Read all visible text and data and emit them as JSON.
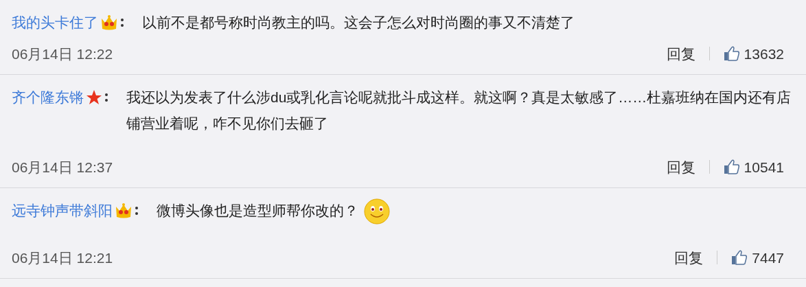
{
  "comments": [
    {
      "user": "我的头卡住了",
      "badge": {
        "kind": "crown"
      },
      "text": "以前不是都号称时尚教主的吗。这会子怎么对时尚圈的事又不清楚了",
      "time": "06月14日 12:22",
      "reply": "回复",
      "likes": "13632"
    },
    {
      "user": "齐个隆东锵",
      "badge": {
        "kind": "star"
      },
      "text": "我还以为发表了什么涉du或乳化言论呢就批斗成这样。就这啊？真是太敏感了……杜嘉班纳在国内还有店铺营业着呢，咋不见你们去砸了",
      "time": "06月14日 12:37",
      "reply": "回复",
      "likes": "10541"
    },
    {
      "user": "远寺钟声带斜阳",
      "badge": {
        "kind": "crown"
      },
      "text": "微博头像也是造型师帮你改的？",
      "emoji": [
        {
          "kind": "smile"
        }
      ],
      "time": "06月14日 12:21",
      "reply": "回复",
      "likes": "7447"
    }
  ]
}
